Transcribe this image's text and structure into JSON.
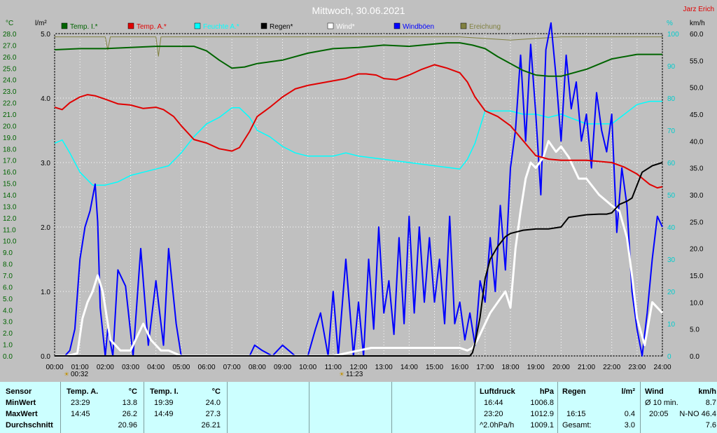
{
  "chart_data": {
    "type": "line",
    "title": "Mittwoch, 30.06.2021",
    "author": "Jarz Erich",
    "x_ticks": [
      "00:00",
      "01:00",
      "02:00",
      "03:00",
      "04:00",
      "05:00",
      "06:00",
      "07:00",
      "08:00",
      "09:00",
      "10:00",
      "11:00",
      "12:00",
      "13:00",
      "14:00",
      "15:00",
      "16:00",
      "17:00",
      "18:00",
      "19:00",
      "20:00",
      "21:00",
      "22:00",
      "23:00",
      "24:00"
    ],
    "xlim_hours": [
      0,
      24
    ],
    "sunrise": "00:32",
    "sunset": "11:23",
    "axis_temp": {
      "unit": "°C",
      "range": [
        0,
        28
      ],
      "ticks": [
        "0.0",
        "1.0",
        "2.0",
        "3.0",
        "4.0",
        "5.0",
        "6.0",
        "7.0",
        "8.0",
        "9.0",
        "10.0",
        "11.0",
        "12.0",
        "13.0",
        "14.0",
        "15.0",
        "16.0",
        "17.0",
        "18.0",
        "19.0",
        "20.0",
        "21.0",
        "22.0",
        "23.0",
        "24.0",
        "25.0",
        "26.0",
        "27.0",
        "28.0"
      ]
    },
    "axis_rain": {
      "unit": "l/m²",
      "range": [
        0,
        5
      ],
      "ticks": [
        "0.0",
        "1.0",
        "2.0",
        "3.0",
        "4.0",
        "5.0"
      ]
    },
    "axis_pct": {
      "unit": "%",
      "range": [
        0,
        100
      ],
      "ticks": [
        "0",
        "10",
        "20",
        "30",
        "40",
        "50",
        "60",
        "70",
        "80",
        "90",
        "100"
      ]
    },
    "axis_wind": {
      "unit": "km/h",
      "range": [
        0,
        60
      ],
      "ticks": [
        "0.0",
        "5.0",
        "10.0",
        "15.0",
        "20.0",
        "25.0",
        "30.0",
        "35.0",
        "40.0",
        "45.0",
        "50.0",
        "55.0",
        "60.0"
      ]
    },
    "legend": [
      {
        "name": "Temp. I.*",
        "color": "#006400"
      },
      {
        "name": "Temp. A.*",
        "color": "#e00000"
      },
      {
        "name": "Feuchte A.*",
        "color": "#00ffff"
      },
      {
        "name": "Regen*",
        "color": "#000000"
      },
      {
        "name": "Wind*",
        "color": "#ffffff"
      },
      {
        "name": "Windböen",
        "color": "#0000ff"
      },
      {
        "name": "Ereichung",
        "color": "#808040"
      }
    ],
    "series": [
      {
        "name": "Temp. I.*",
        "axis": "temp",
        "color": "#006400",
        "x": [
          0,
          1,
          2,
          3,
          4,
          5,
          5.5,
          6,
          6.5,
          7,
          7.5,
          8,
          9,
          10,
          11,
          12,
          13,
          14,
          15,
          15.5,
          16,
          16.5,
          17,
          17.5,
          18,
          18.5,
          19,
          19.5,
          20,
          21,
          22,
          23,
          24
        ],
        "y": [
          26.6,
          26.7,
          26.7,
          26.8,
          26.9,
          26.9,
          26.9,
          26.5,
          25.7,
          25.0,
          25.1,
          25.4,
          25.7,
          26.3,
          26.7,
          26.8,
          27.0,
          26.9,
          27.1,
          27.2,
          27.2,
          27.0,
          26.7,
          26.0,
          25.4,
          24.8,
          24.4,
          24.3,
          24.3,
          24.9,
          25.8,
          26.2,
          26.2
        ]
      },
      {
        "name": "Temp. A.*",
        "axis": "temp",
        "color": "#e00000",
        "x": [
          0,
          0.3,
          0.6,
          1,
          1.3,
          1.6,
          2,
          2.5,
          3,
          3.5,
          4,
          4.3,
          4.7,
          5,
          5.5,
          6,
          6.5,
          7,
          7.3,
          7.7,
          8,
          8.5,
          9,
          9.5,
          10,
          10.5,
          11,
          11.5,
          12,
          12.3,
          12.7,
          13,
          13.5,
          14,
          14.5,
          15,
          15.5,
          16,
          16.3,
          16.6,
          17,
          17.5,
          18,
          18.5,
          19,
          19.5,
          20,
          21,
          22,
          22.5,
          23,
          23.5,
          23.8,
          24
        ],
        "y": [
          21.6,
          21.4,
          22.0,
          22.5,
          22.7,
          22.6,
          22.3,
          21.9,
          21.8,
          21.5,
          21.6,
          21.4,
          20.8,
          20.0,
          18.8,
          18.5,
          18.0,
          17.8,
          18.1,
          19.5,
          20.8,
          21.6,
          22.5,
          23.2,
          23.5,
          23.7,
          23.9,
          24.1,
          24.5,
          24.5,
          24.4,
          24.1,
          24.0,
          24.4,
          24.9,
          25.3,
          25.0,
          24.6,
          23.8,
          22.5,
          21.3,
          20.8,
          20.0,
          18.7,
          17.4,
          17.1,
          17.0,
          17.0,
          16.8,
          16.4,
          15.8,
          14.9,
          14.6,
          14.7
        ]
      },
      {
        "name": "Feuchte A.*",
        "axis": "pct",
        "color": "#00ffff",
        "x": [
          0,
          0.3,
          0.6,
          1,
          1.5,
          1.8,
          2,
          2.5,
          3,
          3.5,
          4,
          4.5,
          5,
          5.5,
          6,
          6.5,
          7,
          7.3,
          7.7,
          8,
          8.5,
          9,
          9.5,
          10,
          10.5,
          11,
          11.5,
          12,
          13,
          14,
          15,
          16,
          16.3,
          16.6,
          17,
          17.5,
          18,
          18.5,
          19,
          19.5,
          20,
          21,
          22,
          22.5,
          23,
          23.5,
          24
        ],
        "y": [
          66,
          67,
          63,
          57,
          53,
          53,
          53,
          54,
          56,
          57,
          58,
          59,
          63,
          68,
          72,
          74,
          77,
          77,
          74,
          70,
          68,
          65,
          63,
          62,
          62,
          62,
          63,
          62,
          61,
          60,
          59,
          58,
          61,
          66,
          76,
          76,
          76,
          75,
          75,
          74,
          75,
          72,
          72,
          75,
          78,
          79,
          79
        ]
      },
      {
        "name": "Regen*",
        "axis": "rain",
        "color": "#000000",
        "x": [
          0,
          16.4,
          16.5,
          16.6,
          16.8,
          17,
          17.2,
          17.5,
          17.8,
          18,
          18.5,
          19,
          19.5,
          20,
          20.3,
          21,
          21.5,
          21.8,
          22,
          22.3,
          22.6,
          22.8,
          23,
          23.2,
          23.6,
          24
        ],
        "y": [
          0,
          0,
          0.05,
          0.2,
          0.6,
          1.2,
          1.5,
          1.7,
          1.85,
          1.9,
          1.95,
          1.97,
          1.97,
          2.0,
          2.15,
          2.19,
          2.2,
          2.2,
          2.22,
          2.35,
          2.4,
          2.45,
          2.65,
          2.85,
          2.95,
          3.0
        ]
      },
      {
        "name": "Wind*",
        "axis": "wind",
        "color": "#ffffff",
        "x": [
          0,
          0.5,
          0.9,
          1.1,
          1.3,
          1.5,
          1.7,
          1.9,
          2.2,
          2.6,
          3,
          3.3,
          3.5,
          3.8,
          4.2,
          4.5,
          5,
          6,
          7,
          8,
          9,
          10,
          11,
          11.5,
          12,
          12.5,
          13,
          13.5,
          14,
          14.5,
          15,
          15.5,
          16,
          16.3,
          16.5,
          16.7,
          17,
          17.2,
          17.5,
          17.8,
          18,
          18.2,
          18.4,
          18.6,
          18.8,
          19,
          19.3,
          19.5,
          19.8,
          20,
          20.3,
          20.7,
          21,
          21.5,
          22,
          22.3,
          22.6,
          22.8,
          23,
          23.3,
          23.6,
          24
        ],
        "y": [
          0,
          0,
          0.5,
          7,
          10,
          12,
          15,
          12,
          3,
          1,
          1,
          4,
          6,
          3,
          1,
          1,
          0,
          0,
          0,
          0,
          0,
          0,
          0,
          0.5,
          1,
          1.5,
          1.5,
          1.5,
          1.5,
          1.5,
          1.5,
          1.5,
          1.5,
          1,
          1.5,
          3,
          6,
          8,
          10,
          12,
          9,
          20,
          27,
          33,
          36,
          35,
          37,
          40,
          38,
          39,
          37,
          33,
          33,
          30,
          28,
          27,
          22,
          15,
          7,
          2,
          10,
          8
        ]
      },
      {
        "name": "Windböen",
        "axis": "wind",
        "color": "#0000ff",
        "x": [
          0,
          0.4,
          0.6,
          0.8,
          1,
          1.2,
          1.4,
          1.6,
          1.7,
          1.8,
          2,
          2.1,
          2.3,
          2.5,
          2.8,
          3.1,
          3.4,
          3.7,
          4,
          4.3,
          4.5,
          4.8,
          5,
          6,
          7,
          7.5,
          7.7,
          7.9,
          8.2,
          8.6,
          9,
          9.5,
          10,
          10.3,
          10.5,
          10.8,
          11,
          11.2,
          11.5,
          11.8,
          12,
          12.2,
          12.4,
          12.6,
          12.8,
          13,
          13.2,
          13.4,
          13.6,
          13.8,
          14,
          14.2,
          14.4,
          14.6,
          14.8,
          15,
          15.2,
          15.4,
          15.6,
          15.8,
          16,
          16.2,
          16.4,
          16.6,
          16.8,
          17,
          17.2,
          17.4,
          17.6,
          17.8,
          18,
          18.2,
          18.4,
          18.6,
          18.8,
          19,
          19.2,
          19.4,
          19.6,
          19.8,
          20,
          20.2,
          20.4,
          20.6,
          20.8,
          21,
          21.2,
          21.4,
          21.6,
          21.8,
          22,
          22.2,
          22.4,
          22.6,
          22.8,
          23,
          23.2,
          23.4,
          23.6,
          23.8,
          24
        ],
        "y": [
          0,
          0,
          1,
          5,
          18,
          24,
          27,
          32,
          25,
          9,
          0,
          5,
          0,
          16,
          13,
          0,
          20,
          2,
          14,
          2,
          20,
          6,
          0,
          0,
          0,
          0,
          0,
          2,
          1,
          0,
          2,
          0,
          0,
          5,
          8,
          0,
          12,
          0,
          18,
          0,
          10,
          0,
          18,
          5,
          24,
          8,
          14,
          4,
          22,
          6,
          26,
          8,
          24,
          10,
          22,
          10,
          18,
          6,
          26,
          6,
          10,
          3,
          8,
          2,
          14,
          10,
          22,
          12,
          28,
          16,
          35,
          42,
          56,
          40,
          58,
          45,
          30,
          57,
          62,
          52,
          40,
          56,
          46,
          51,
          40,
          45,
          35,
          49,
          42,
          38,
          45,
          23,
          35,
          28,
          12,
          5,
          0,
          8,
          18,
          26,
          24
        ]
      },
      {
        "name": "Ereichung",
        "axis": "pct",
        "color": "#808040",
        "x": [
          0,
          2,
          2.1,
          2.2,
          4,
          4.1,
          4.2,
          6,
          8,
          10,
          12,
          14,
          16,
          18,
          20,
          22,
          24
        ],
        "y": [
          99,
          99,
          95,
          99,
          99,
          93,
          99,
          99,
          99,
          99,
          99,
          99,
          99,
          98,
          99,
          99,
          99
        ]
      }
    ]
  },
  "panel": {
    "sensor": {
      "header": "Sensor",
      "rows": [
        "MinWert",
        "MaxWert",
        "Durchschnitt"
      ]
    },
    "temp_a": {
      "header": "Temp. A.",
      "unit": "°C",
      "min_time": "23:29",
      "min_val": "13.8",
      "max_time": "14:45",
      "max_val": "26.2",
      "avg": "20.96"
    },
    "temp_i": {
      "header": "Temp. I.",
      "unit": "°C",
      "min_time": "19:39",
      "min_val": "24.0",
      "max_time": "14:49",
      "max_val": "27.3",
      "avg": "26.21"
    },
    "pressure": {
      "header": "Luftdruck",
      "unit": "hPa",
      "min_time": "16:44",
      "min_val": "1006.8",
      "max_time": "23:20",
      "max_val": "1012.9",
      "trend_label": "^2.0hPa/h",
      "trend_val": "1009.1"
    },
    "rain": {
      "header": "Regen",
      "unit": "l/m²",
      "row2_time": "16:15",
      "row2_val": "0.4",
      "total_label": "Gesamt:",
      "total_val": "3.0"
    },
    "wind": {
      "header": "Wind",
      "unit": "km/h",
      "row1_label": "Ø 10 min.",
      "row1_val": "8.7",
      "row2_time": "20:05",
      "row2_val": "N-NO 46.4",
      "row3_val": "7.6"
    }
  }
}
